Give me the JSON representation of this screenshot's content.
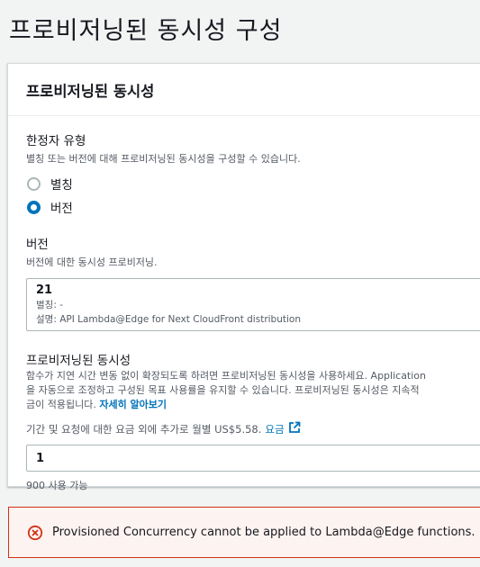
{
  "page": {
    "title": "프로비저닝된 동시성 구성"
  },
  "panel": {
    "title": "프로비저닝된 동시성",
    "qualifier": {
      "label": "한정자 유형",
      "description": "별칭 또는 버전에 대해 프로비저닝된 동시성을 구성할 수 있습니다.",
      "options": [
        {
          "label": "별칭",
          "checked": false
        },
        {
          "label": "버전",
          "checked": true
        }
      ]
    },
    "version": {
      "label": "버전",
      "description": "버전에 대한 동시성 프로비저닝.",
      "number": "21",
      "alias_line": "별칭: -",
      "description_line": "설명: API Lambda@Edge for Next CloudFront distribution"
    },
    "concurrency": {
      "label": "프로비저닝된 동시성",
      "description_lines": [
        "함수가 지연 시간 변동 없이 확장되도록 하려면 프로비저닝된 동시성을 사용하세요. Application",
        "을 자동으로 조정하고 구성된 목표 사용률을 유지할 수 있습니다. 프로비저닝된 동시성은 지속적",
        "금이 적용됩니다."
      ],
      "learn_more": "자세히 알아보기",
      "price_text": "기간 및 요청에 대한 요금 외에 추가로 월별 US$5.58.",
      "price_link": "요금",
      "value": "1",
      "available": "900 사용 가능"
    }
  },
  "error": {
    "message": "Provisioned Concurrency cannot be applied to Lambda@Edge functions."
  },
  "colors": {
    "accent": "#0073bb",
    "error_border": "#d13212",
    "error_bg": "#fdf3f1"
  },
  "icons": {
    "external_link": "external-link-icon",
    "error": "error-circle-x-icon"
  }
}
